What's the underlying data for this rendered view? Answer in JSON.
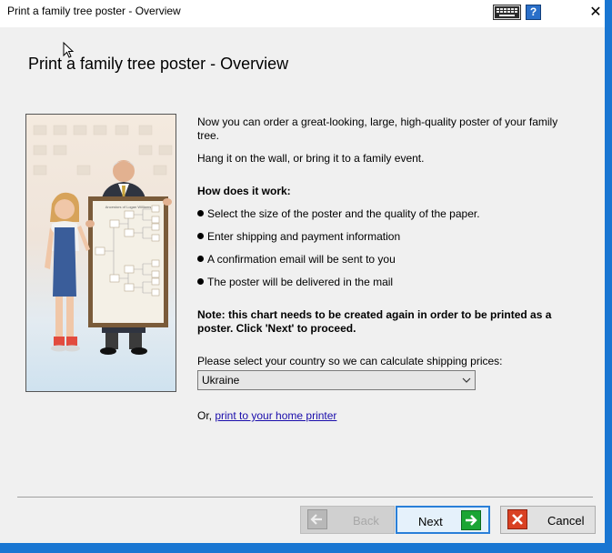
{
  "window": {
    "title": "Print a family tree poster - Overview",
    "close_glyph": "✕",
    "help_glyph": "?"
  },
  "header": {
    "title": "Print a family tree poster - Overview"
  },
  "photo": {
    "poster_caption": "Ancestors of Logan Williams"
  },
  "content": {
    "intro": "Now you can order a great-looking, large, high-quality poster of your family tree.",
    "hang": "Hang it on the wall, or bring it to a family event.",
    "how_heading": "How does it work:",
    "steps": [
      "Select the size of the poster and the quality of the paper.",
      "Enter shipping and payment information",
      "A confirmation email will be sent to you",
      "The poster will be delivered in the mail"
    ],
    "note": "Note: this chart needs to be created again in order to be printed as a poster. Click 'Next' to proceed.",
    "country_label": "Please select your country so we can calculate shipping prices:",
    "country_value": "Ukraine",
    "or_text": "Or, ",
    "print_link": "print to your home printer"
  },
  "buttons": {
    "back": "Back",
    "next": "Next",
    "cancel": "Cancel"
  },
  "colors": {
    "accent": "#1976d2",
    "next_icon": "#1aa534",
    "cancel_icon": "#d94123",
    "link": "#1a0dab"
  },
  "icons": [
    "keyboard-icon",
    "help-icon",
    "close-icon",
    "arrow-left-icon",
    "arrow-right-icon",
    "x-icon",
    "chevron-down-icon",
    "mouse-cursor-icon"
  ]
}
